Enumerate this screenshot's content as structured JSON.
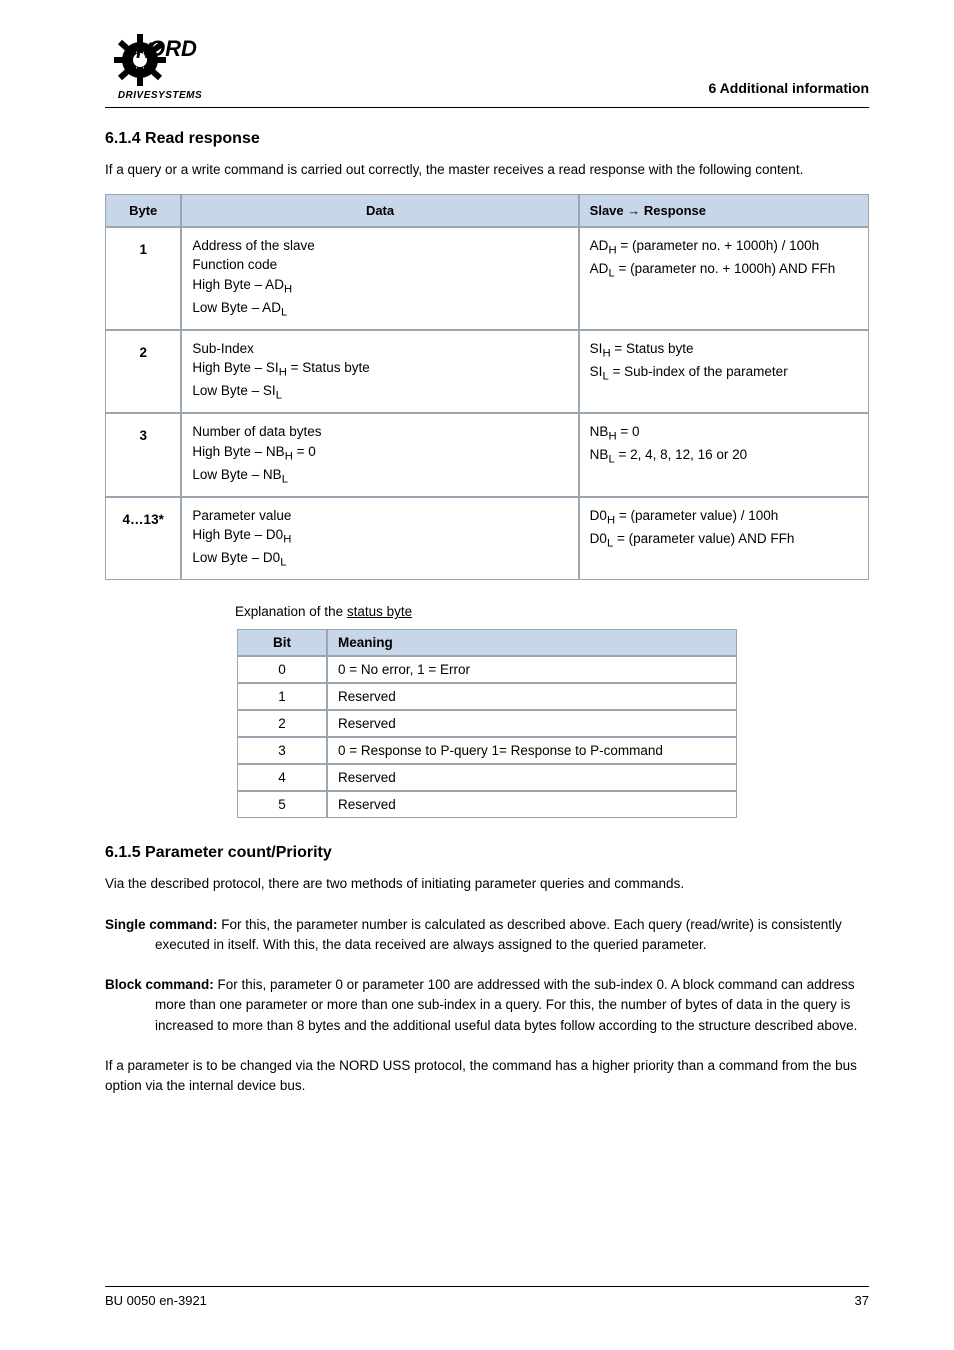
{
  "logo": {
    "sub": "DRIVESYSTEMS"
  },
  "header_right": "6 Additional information",
  "section1": {
    "title": "6.1.4  Read response",
    "text": "If a query or a write command is carried out correctly, the master receives a read response with the following content.",
    "table_headers": {
      "byte": "Byte",
      "data": "Data",
      "response": "Slave → Response"
    },
    "rows": [
      {
        "byte": "1",
        "data_lines": [
          "Address of the slave",
          "Function code"
        ],
        "data_sub": [
          "High Byte – AD<sub>H</sub>",
          "Low Byte – AD<sub>L</sub>"
        ],
        "resp_sub": [
          "AD<sub>H</sub> = (parameter no. + 1000h) / 100h",
          "AD<sub>L</sub> = (parameter no. + 1000h) AND FFh"
        ]
      },
      {
        "byte": "2",
        "data_lines": [
          "Sub-Index"
        ],
        "data_sub": [
          "High Byte – SI<sub>H</sub> = Status byte",
          "Low Byte – SI<sub>L</sub>"
        ],
        "resp_sub": [
          "SI<sub>H</sub> = Status byte",
          "SI<sub>L</sub> = Sub-index of the parameter"
        ]
      },
      {
        "byte": "3",
        "data_lines": [
          "Number of data bytes"
        ],
        "data_sub": [
          "High Byte – NB<sub>H</sub> = 0",
          "Low Byte – NB<sub>L</sub>"
        ],
        "resp_sub": [
          "NB<sub>H</sub> = 0",
          "NB<sub>L</sub> = 2, 4, 8, 12, 16 or 20"
        ]
      },
      {
        "byte": "4…13*",
        "data_lines": [
          "Parameter value"
        ],
        "data_sub": [
          "High Byte – D0<sub>H</sub>",
          "Low Byte – D0<sub>L</sub>"
        ],
        "resp_sub": [
          "D0<sub>H</sub> = (parameter value) / 100h",
          "D0<sub>L</sub> = (parameter value) AND FFh"
        ]
      }
    ],
    "explain_label": "Explanation of the",
    "explain_underline": "status byte",
    "table2_headers": {
      "bit": "Bit",
      "meaning": "Meaning"
    },
    "table2_rows": [
      {
        "bit": "0",
        "meaning": "0 = No error, 1 = Error"
      },
      {
        "bit": "1",
        "meaning": "Reserved"
      },
      {
        "bit": "2",
        "meaning": "Reserved"
      },
      {
        "bit": "3",
        "meaning": "0 = Response to P-query 1= Response to P-command"
      },
      {
        "bit": "4",
        "meaning": "Reserved"
      },
      {
        "bit": "5",
        "meaning": "Reserved"
      }
    ]
  },
  "section2": {
    "title": "6.1.5  Parameter count/Priority",
    "p1": "Via the described protocol, there are two methods of initiating parameter queries and commands.",
    "p2_bold": "Single command:",
    "p2_text": "  For this, the parameter number is calculated as described above. Each query (read/write) is consistently executed in itself. With this, the data received are always assigned to the queried parameter.",
    "p3_bold": "Block command:",
    "p3_text": "  For this, parameter 0 or parameter 100 are addressed with the sub-index 0. A block command can address more than one parameter or more than one sub-index in a query. For this, the number of bytes of data in the query is increased to more than 8 bytes and the additional useful data bytes follow according to the structure described above.",
    "p4": "If a parameter is to be changed via the NORD USS protocol, the command has a higher priority than a command from the bus option via the internal device bus."
  },
  "footer": {
    "left": "BU 0050 en-3921",
    "right": "37"
  }
}
